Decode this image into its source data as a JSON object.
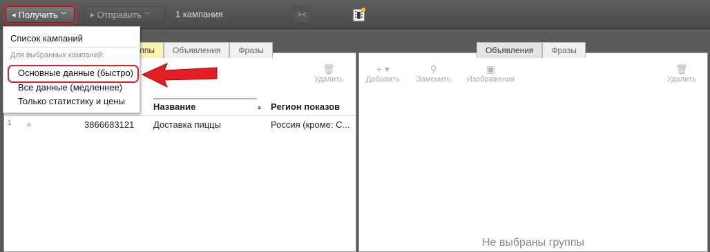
{
  "toolbar": {
    "get_label": "Получить",
    "send_label": "Отправить",
    "campaign_count": "1 кампания"
  },
  "dropdown": {
    "campaign_list": "Список кампаний",
    "caption": "Для выбранных кампаний:",
    "items": [
      "Основные данные (быстро)",
      "Все данные (медленнее)",
      "Только статистику и цены"
    ]
  },
  "left_panel": {
    "tabs": [
      "Группы",
      "Объявления",
      "Фразы"
    ],
    "delete_label": "Удалить",
    "columns": [
      "Название",
      "Регион показов"
    ],
    "rows": [
      {
        "num": "1",
        "id": "3866683121",
        "name": "Доставка пиццы",
        "region": "Россия (кроме: С..."
      }
    ]
  },
  "right_panel": {
    "tabs": [
      "Объявления",
      "Фразы"
    ],
    "tools": [
      "Добавить",
      "Заменить",
      "Изображения",
      "Удалить"
    ],
    "empty_message": "Не выбраны группы"
  },
  "colors": {
    "highlight": "#e31e24",
    "active_tab": "#fff3b0"
  },
  "icons": [
    "send-icon",
    "receive-icon",
    "chevron-down-icon",
    "collapse-icon",
    "film-icon",
    "trash-icon",
    "plus-icon",
    "search-icon",
    "image-icon",
    "star-icon",
    "sort-arrow-icon"
  ]
}
